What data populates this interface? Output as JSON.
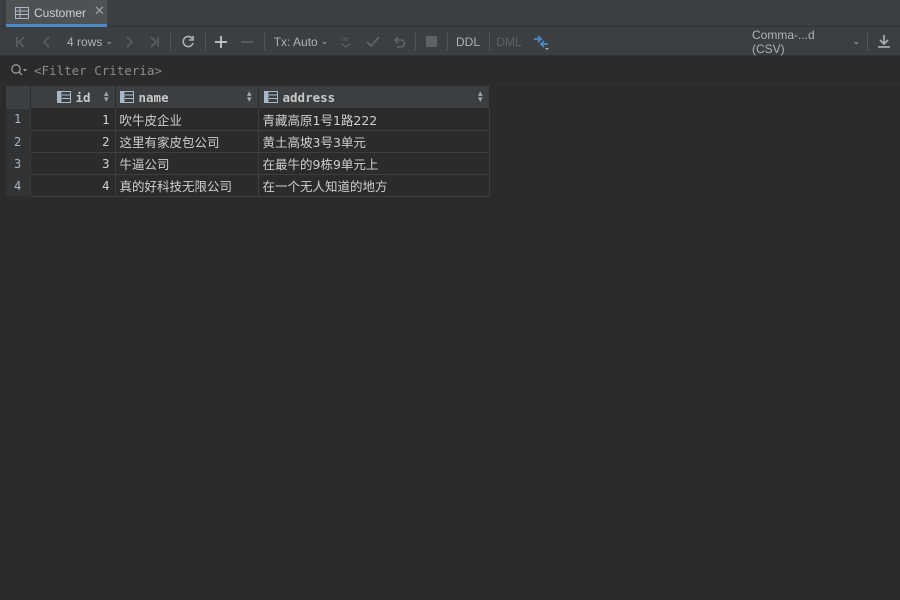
{
  "tab": {
    "label": "Customer",
    "close": "✕"
  },
  "toolbar": {
    "rows_label": "4 rows",
    "tx_label": "Tx: Auto",
    "ddl_label": "DDL",
    "dml_label": "DML",
    "export_format": "Comma-...d (CSV)"
  },
  "filter": {
    "placeholder": "<Filter Criteria>",
    "value": ""
  },
  "table": {
    "columns": [
      "id",
      "name",
      "address"
    ],
    "rows": [
      {
        "row_num": "1",
        "id": "1",
        "name": "吹牛皮企业",
        "address": "青藏高原1号1路222"
      },
      {
        "row_num": "2",
        "id": "2",
        "name": "这里有家皮包公司",
        "address": "黄土高坡3号3单元"
      },
      {
        "row_num": "3",
        "id": "3",
        "name": "牛逼公司",
        "address": "在最牛的9栋9单元上"
      },
      {
        "row_num": "4",
        "id": "4",
        "name": "真的好科技无限公司",
        "address": "在一个无人知道的地方"
      }
    ]
  },
  "colors": {
    "accent": "#4a88c7",
    "background": "#2b2b2b",
    "toolbar": "#3c3f41"
  },
  "icons": [
    "table-icon",
    "close-icon",
    "first-page-icon",
    "prev-page-icon",
    "next-page-icon",
    "last-page-icon",
    "refresh-icon",
    "add-row-icon",
    "delete-row-icon",
    "submit-icon",
    "commit-icon",
    "rollback-icon",
    "stop-icon",
    "compare-icon",
    "download-icon",
    "search-icon",
    "column-icon"
  ]
}
